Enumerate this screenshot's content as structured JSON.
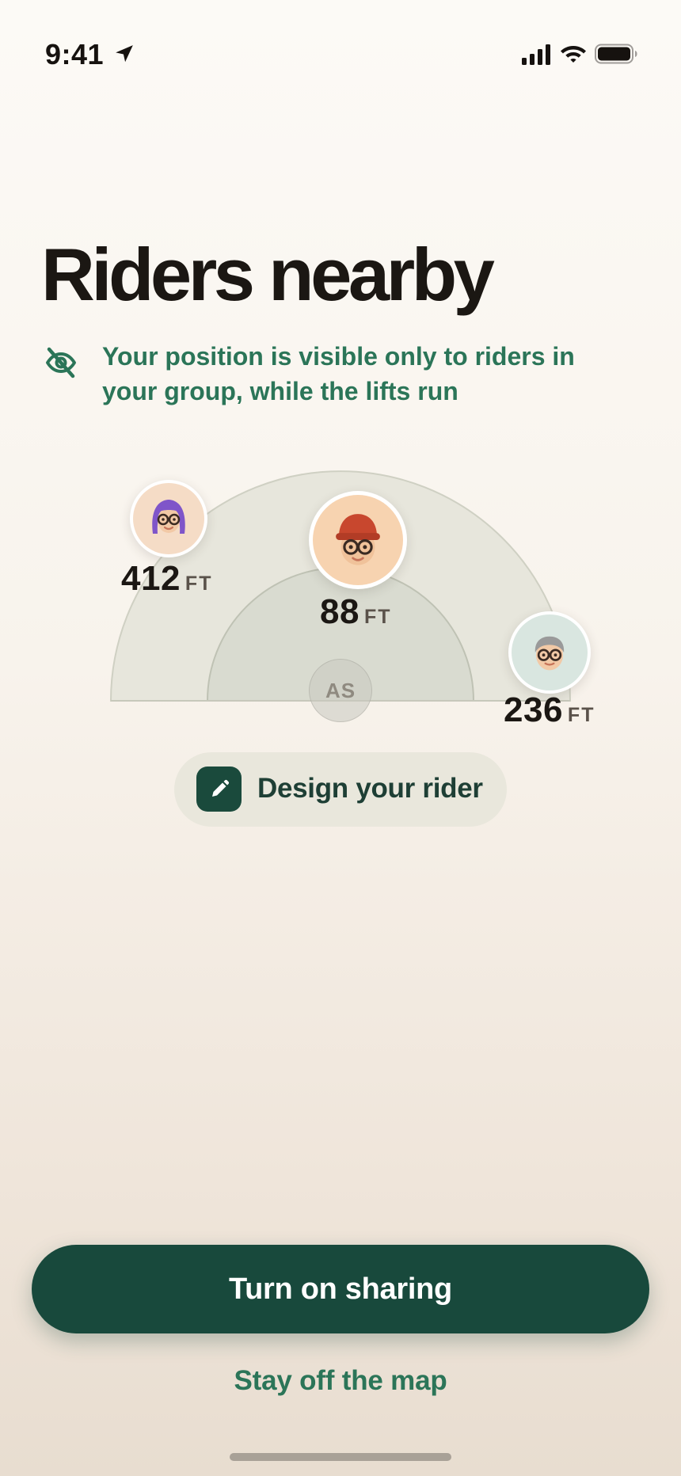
{
  "status_bar": {
    "time": "9:41",
    "icons": [
      "location-arrow-icon",
      "cellular-signal-icon",
      "wifi-icon",
      "battery-icon"
    ]
  },
  "header": {
    "title": "Riders nearby",
    "privacy_note": "Your position is visible only to riders in your group, while the lifts run",
    "privacy_icon": "eye-off-icon"
  },
  "radar": {
    "self_initials": "AS",
    "riders": [
      {
        "distance": "412",
        "unit": "FT",
        "avatar": "purple-hair-glasses-avatar"
      },
      {
        "distance": "88",
        "unit": "FT",
        "avatar": "red-beanie-glasses-avatar"
      },
      {
        "distance": "236",
        "unit": "FT",
        "avatar": "gray-hair-glasses-avatar"
      }
    ]
  },
  "design_button": {
    "label": "Design your rider",
    "icon": "pencil-icon"
  },
  "actions": {
    "primary": "Turn on sharing",
    "secondary": "Stay off the map"
  },
  "colors": {
    "brand_dark_green": "#18493c",
    "accent_green": "#2b7558",
    "title": "#1b1713",
    "pill_background": "#e9e7dc"
  }
}
